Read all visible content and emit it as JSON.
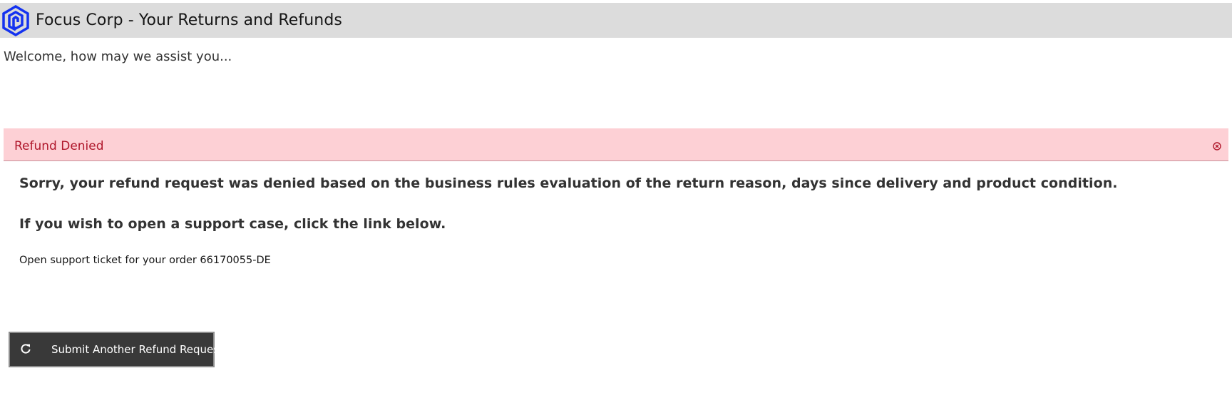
{
  "header": {
    "logo_icon": "hexagon-spiral-logo-icon",
    "brand_color": "#1432f0",
    "title": "Focus Corp - Your Returns and Refunds"
  },
  "welcome_text": "Welcome, how may we assist you...",
  "alert": {
    "title": "Refund Denied",
    "close_icon": "close-circle-icon",
    "background_color": "#fdd0d5",
    "title_color": "#b0182c"
  },
  "message": {
    "line1": "Sorry, your refund request was denied based on the business rules evaluation of the return reason, days since delivery and product condition.",
    "line2": "If you wish to open a support case, click the link below.",
    "ticket_link": "Open support ticket for your order 66170055-DE"
  },
  "actions": {
    "submit_another_label": "Submit Another Refund Request",
    "submit_another_icon": "refresh-icon"
  }
}
